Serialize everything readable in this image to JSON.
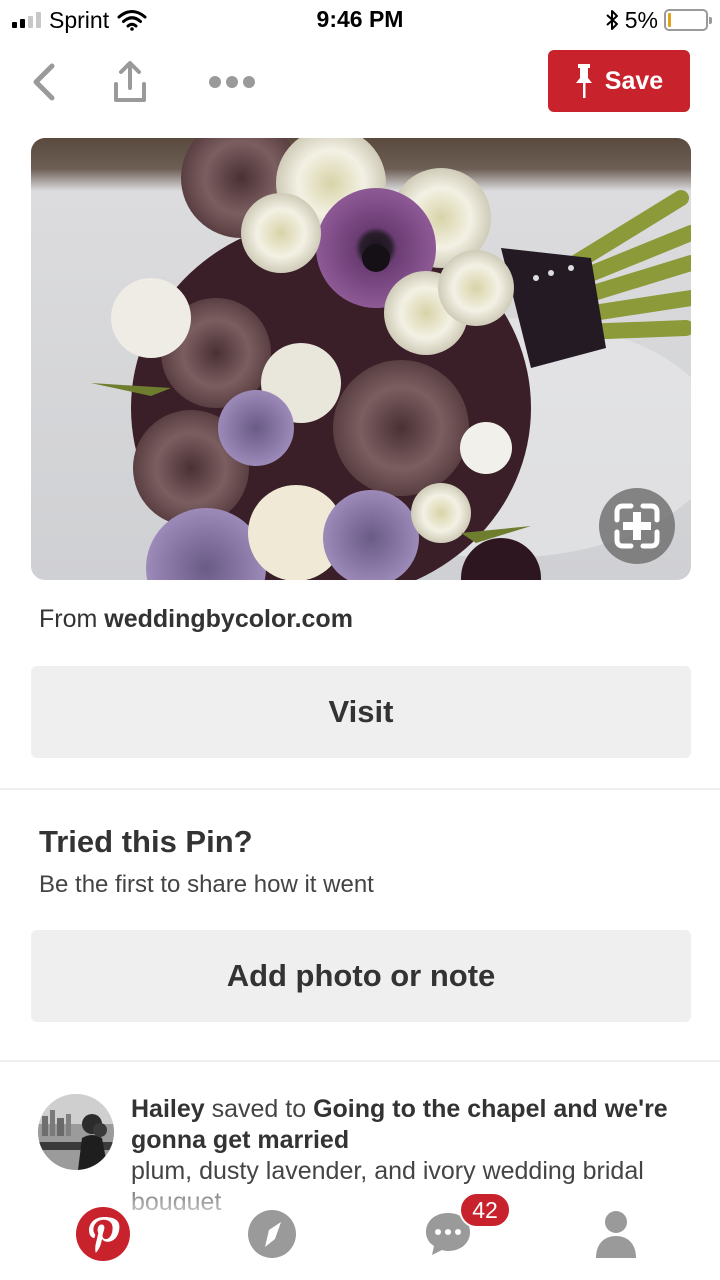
{
  "status_bar": {
    "carrier": "Sprint",
    "time": "9:46 PM",
    "battery_percent": "5%",
    "battery_level": 0.05,
    "signal_bars": 2,
    "icons": [
      "signal-icon",
      "wifi-icon",
      "bluetooth-icon",
      "battery-icon"
    ]
  },
  "nav": {
    "icons": [
      "chevron-left-icon",
      "share-icon",
      "more-icon",
      "pin-icon"
    ],
    "save_label": "Save"
  },
  "pin": {
    "source_prefix": "From",
    "source_domain": "weddingbycolor.com",
    "visual_search_icon": "lens-icon"
  },
  "visit_label": "Visit",
  "tried": {
    "title": "Tried this Pin?",
    "subtitle": "Be the first to share how it went",
    "button_label": "Add photo or note"
  },
  "activity": {
    "user": "Hailey",
    "action": "saved to",
    "board": "Going to the chapel and we're gonna get married",
    "description": "plum, dusty lavender, and ivory wedding bridal bouquet"
  },
  "tab_bar": {
    "tabs": [
      "home",
      "explore",
      "messages",
      "profile"
    ],
    "icons": [
      "pinterest-logo-icon",
      "compass-icon",
      "chat-bubble-icon",
      "person-icon"
    ],
    "messages_badge": "42"
  },
  "colors": {
    "brand_red": "#c8232c",
    "button_gray": "#efefef",
    "text": "#333333"
  }
}
